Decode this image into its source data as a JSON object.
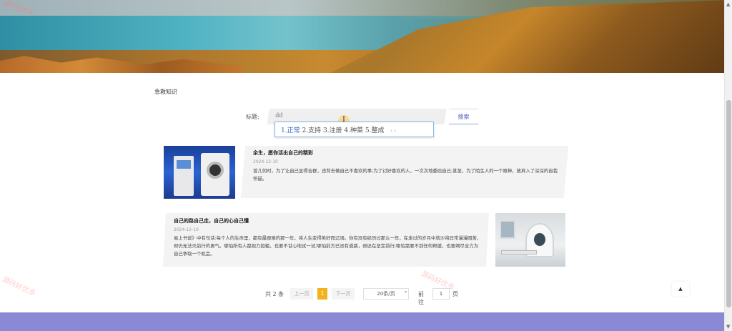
{
  "section": {
    "title": "急救知识"
  },
  "search": {
    "label": "标题:",
    "value": "dd",
    "button": "搜索",
    "ime_candidates": [
      "1.正常",
      "2.支持",
      "3.注册",
      "4.种菜",
      "5.整成"
    ],
    "ime_more": "‹ ›"
  },
  "articles": [
    {
      "title": "余生，愿你活出自己的精彩",
      "date": "2024-12-10",
      "text": "曾几何时，为了让自己显得合群，违背去做自己不喜欢的事;为了讨好喜欢的人，一次次地委屈自己;甚至，为了陌生人的一个眼神，放弃入了深深的自我怀疑。"
    },
    {
      "title": "自己的路自己走，自己的心自己懂",
      "date": "2024-12-10",
      "text": "易上书说》中有句话:每个人的生命里，都有最艰难的那一年，将人生变得美好而辽阔。你有没有经历过那么一年，在走过的岁月中就沙将异常漫漫困苦，却仍无法灭前行的勇气。哪怕所有人都视力如粗，也要不甘心地试一试;哪怕前方已没有道路，却还在坚定前行;哪怕需要不到任何帮援，也要竭尽全力为自己争取一个机会。"
    }
  ],
  "pagination": {
    "total": "共 2 条",
    "prev": "上一页",
    "current": "1",
    "next": "下一页",
    "page_size": "20条/页",
    "goto_label": "前往",
    "goto_value": "1",
    "page_suffix": "页"
  },
  "watermark": "源码好优多",
  "back_top": "▲"
}
